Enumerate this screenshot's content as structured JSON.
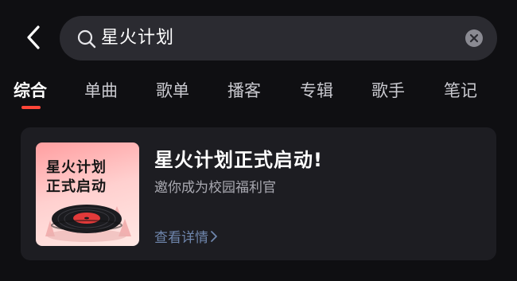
{
  "search": {
    "query": "星火计划"
  },
  "tabs": [
    {
      "label": "综合",
      "active": true
    },
    {
      "label": "单曲",
      "active": false
    },
    {
      "label": "歌单",
      "active": false
    },
    {
      "label": "播客",
      "active": false
    },
    {
      "label": "专辑",
      "active": false
    },
    {
      "label": "歌手",
      "active": false
    },
    {
      "label": "笔记",
      "active": false
    }
  ],
  "result_card": {
    "cover_title_line1": "星火计划",
    "cover_title_line2": "正式启动",
    "title": "星火计划正式启动!",
    "subtitle": "邀你成为校园福利官",
    "link_label": "查看详情"
  },
  "colors": {
    "accent": "#ff4638",
    "link": "#6f86ad",
    "background": "#0f0f12",
    "card": "#1d1d22",
    "search_bg": "#2b2b31"
  },
  "icons": [
    "back-arrow-icon",
    "search-icon",
    "clear-icon",
    "chevron-right-icon"
  ]
}
